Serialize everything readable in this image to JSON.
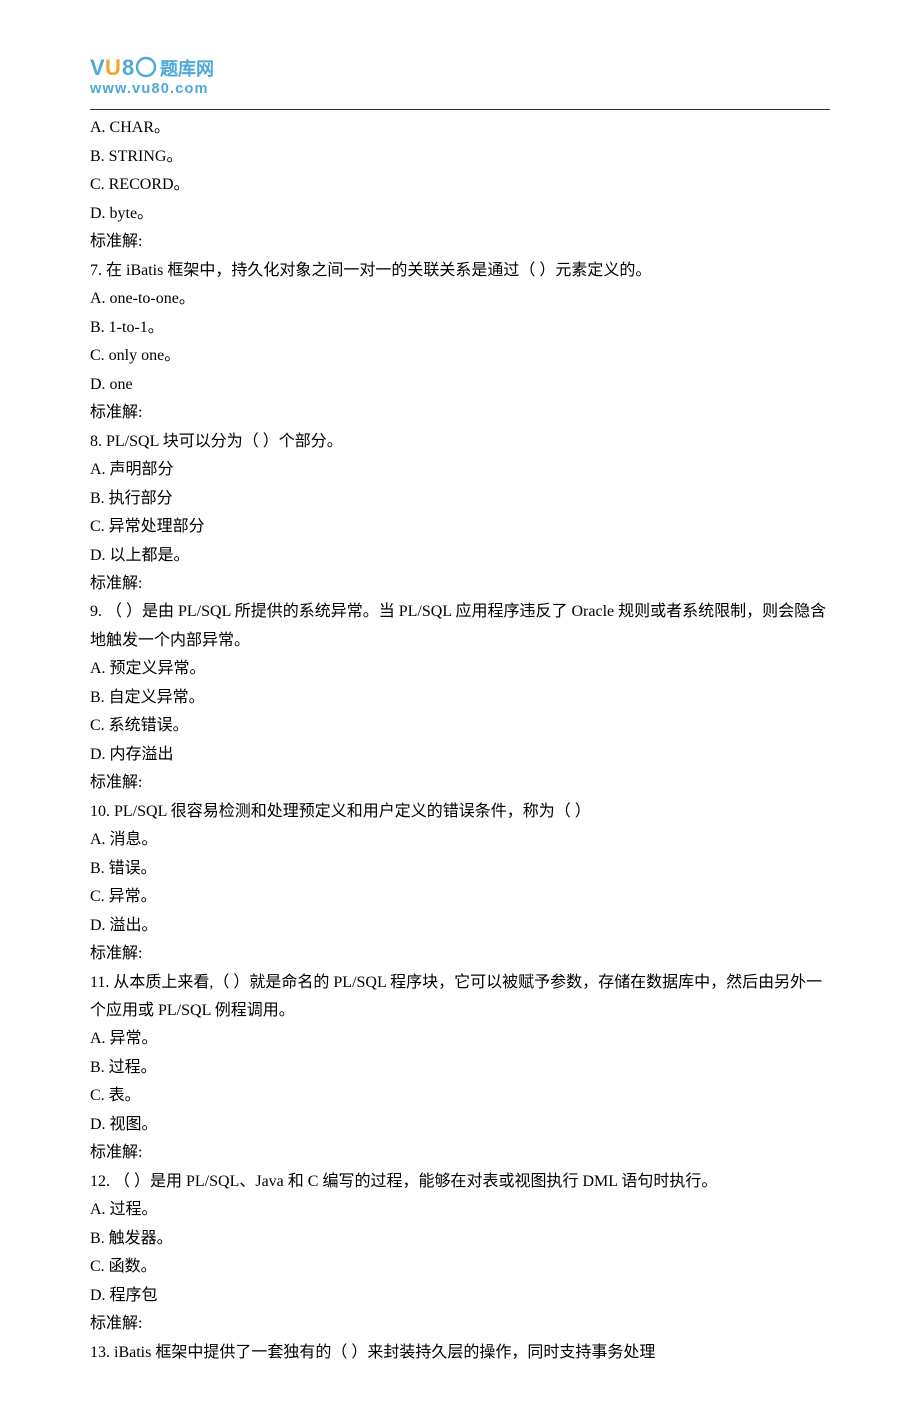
{
  "logo": {
    "main_text": "题库网",
    "url_text": "www.vu80.com"
  },
  "pre_options": [
    "A. CHAR。",
    "B. STRING。",
    "C. RECORD。",
    "D. byte。"
  ],
  "pre_answer": "标准解:",
  "questions": [
    {
      "num": "7. ",
      "text": "  在 iBatis 框架中，持久化对象之间一对一的关联关系是通过（ ）元素定义的。",
      "opts": [
        "A. one-to-one。",
        "B. 1-to-1。",
        "C. only one。",
        "D. one"
      ],
      "ans": "标准解:"
    },
    {
      "num": "8. ",
      "text": "  PL/SQL 块可以分为（ ）个部分。",
      "opts": [
        "A. 声明部分",
        "B. 执行部分",
        "C. 异常处理部分",
        "D. 以上都是。"
      ],
      "ans": "标准解:"
    },
    {
      "num": "9. ",
      "text": "  （ ）是由 PL/SQL 所提供的系统异常。当 PL/SQL 应用程序违反了 Oracle 规则或者系统限制，则会隐含地触发一个内部异常。",
      "opts": [
        "A. 预定义异常。",
        "B. 自定义异常。",
        "C. 系统错误。",
        "D. 内存溢出"
      ],
      "ans": "标准解:"
    },
    {
      "num": "10. ",
      "text": "  PL/SQL 很容易检测和处理预定义和用户定义的错误条件，称为（ ）",
      "opts": [
        "A. 消息。",
        "B. 错误。",
        "C. 异常。",
        "D. 溢出。"
      ],
      "ans": "标准解:"
    },
    {
      "num": "11. ",
      "text": "  从本质上来看,（ ）就是命名的 PL/SQL 程序块，它可以被赋予参数，存储在数据库中，然后由另外一个应用或 PL/SQL 例程调用。",
      "opts": [
        "A. 异常。",
        "B. 过程。",
        "C. 表。",
        "D. 视图。"
      ],
      "ans": "标准解:"
    },
    {
      "num": "12. ",
      "text": "  （ ）是用 PL/SQL、Java 和 C 编写的过程，能够在对表或视图执行 DML 语句时执行。",
      "opts": [
        "A. 过程。",
        "B. 触发器。",
        "C. 函数。",
        "D. 程序包"
      ],
      "ans": "标准解:"
    },
    {
      "num": "13. ",
      "text": "  iBatis 框架中提供了一套独有的（ ）来封装持久层的操作，同时支持事务处理",
      "opts": [],
      "ans": ""
    }
  ]
}
